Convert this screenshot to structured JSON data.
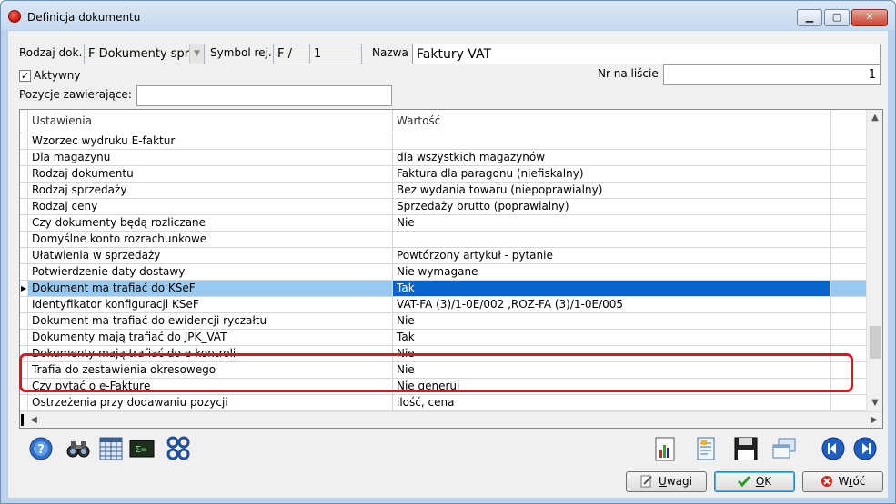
{
  "window": {
    "title": "Definicja dokumentu",
    "controls": [
      "minimize",
      "maximize",
      "close"
    ]
  },
  "form": {
    "rodzaj_label": "Rodzaj dok.",
    "rodzaj_value": "F  Dokumenty sprz",
    "symbol_label": "Symbol rej.",
    "symbol_value": "F /",
    "symbol_num": "1",
    "nazwa_label": "Nazwa",
    "nazwa_value": "Faktury VAT",
    "aktywny_label": "Aktywny",
    "aktywny_checked": true,
    "nr_label": "Nr na liście",
    "nr_value": "1",
    "pozycje_label": "Pozycje zawierające:",
    "pozycje_value": ""
  },
  "grid": {
    "headers": [
      "Ustawienia",
      "Wartość"
    ],
    "rows": [
      {
        "setting": "Wzorzec wydruku E-faktur",
        "value": ""
      },
      {
        "setting": "Dla magazynu",
        "value": "dla wszystkich magazynów"
      },
      {
        "setting": "Rodzaj dokumentu",
        "value": "Faktura dla paragonu (niefiskalny)"
      },
      {
        "setting": "Rodzaj sprzedaży",
        "value": "Bez wydania towaru  (niepoprawialny)"
      },
      {
        "setting": "Rodzaj ceny",
        "value": "Sprzedaży brutto  (poprawialny)"
      },
      {
        "setting": "Czy dokumenty będą rozliczane",
        "value": "Nie"
      },
      {
        "setting": "Domyślne konto rozrachunkowe",
        "value": ""
      },
      {
        "setting": "Ułatwienia w sprzedaży",
        "value": "Powtórzony artykuł - pytanie"
      },
      {
        "setting": "Potwierdzenie daty dostawy",
        "value": "Nie wymagane"
      },
      {
        "setting": "Dokument ma trafiać do KSeF",
        "value": "Tak",
        "selected": true
      },
      {
        "setting": "Identyfikator konfiguracji KSeF",
        "value": "VAT-FA (3)/1-0E/002 ,ROZ-FA (3)/1-0E/005"
      },
      {
        "setting": "Dokument ma trafiać do ewidencji ryczałtu",
        "value": "Nie"
      },
      {
        "setting": "Dokumenty mają trafiać do JPK_VAT",
        "value": "Tak"
      },
      {
        "setting": "Dokumenty mają trafiać do e-kontroli",
        "value": "Nie"
      },
      {
        "setting": "Trafia do zestawienia okresowego",
        "value": "Nie"
      },
      {
        "setting": "Czy pytać o e-Fakturę",
        "value": "Nie generuj"
      },
      {
        "setting": "Ostrzeżenia przy dodawaniu pozycji",
        "value": "ilość, cena"
      }
    ]
  },
  "toolbar": {
    "left_icons": [
      "help-icon",
      "binoculars-icon",
      "calendar-grid-icon",
      "calculator-icon",
      "settings-gears-icon"
    ],
    "right_icons": [
      "chart-report-icon",
      "document-edit-icon",
      "save-floppy-icon",
      "windows-stack-icon",
      "previous-icon",
      "next-icon"
    ]
  },
  "buttons": {
    "uwagi": {
      "underlined": "U",
      "rest": "wagi"
    },
    "ok": {
      "underlined": "O",
      "rest": "K"
    },
    "wroc": {
      "prefix": "W",
      "underlined": "r",
      "rest": "óć"
    }
  },
  "colors": {
    "selection": "#0a64c8",
    "selection_row": "#99c9ef",
    "highlight_border": "#e8101e"
  }
}
